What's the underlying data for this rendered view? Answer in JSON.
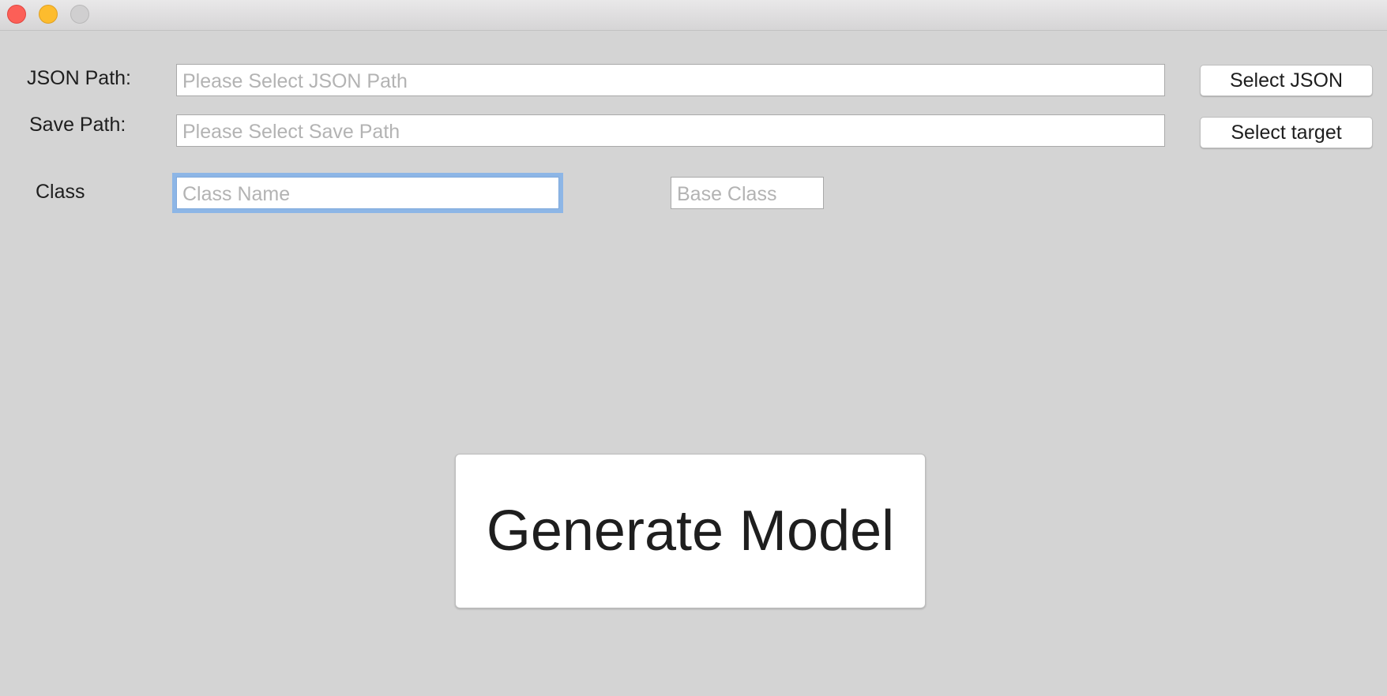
{
  "window": {
    "controls": {
      "close_icon": "close-icon",
      "minimize_icon": "minimize-icon",
      "maximize_icon": "maximize-icon"
    }
  },
  "form": {
    "json_path": {
      "label": "JSON Path:",
      "value": "",
      "placeholder": "Please Select JSON Path",
      "button_label": "Select JSON"
    },
    "save_path": {
      "label": "Save Path:",
      "value": "",
      "placeholder": "Please Select Save Path",
      "button_label": "Select target"
    },
    "class": {
      "label": "Class",
      "class_name_value": "",
      "class_name_placeholder": "Class Name",
      "base_class_value": "",
      "base_class_placeholder": "Base Class"
    }
  },
  "actions": {
    "generate_label": "Generate Model"
  },
  "colors": {
    "window_bg": "#d4d4d4",
    "focus_ring": "#8db6e6",
    "close": "#fc5f57",
    "minimize": "#fdbc2e",
    "maximize_inactive": "#d0cfd0"
  }
}
